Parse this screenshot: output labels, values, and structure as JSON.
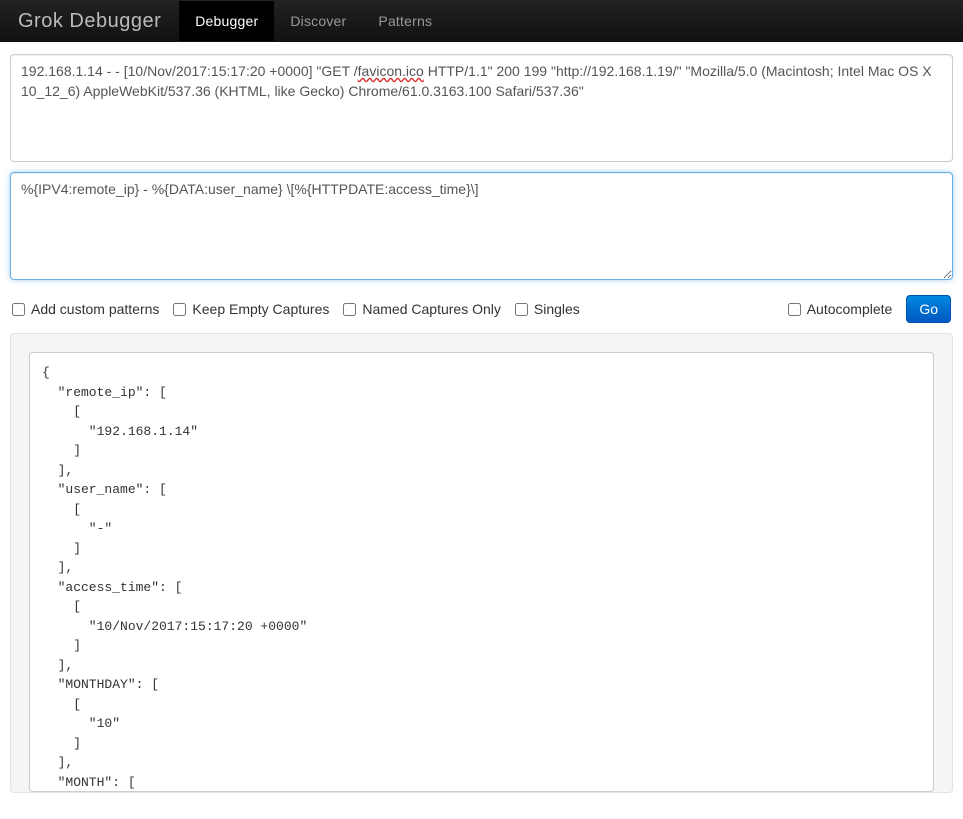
{
  "nav": {
    "brand": "Grok Debugger",
    "items": [
      {
        "label": "Debugger",
        "active": true
      },
      {
        "label": "Discover",
        "active": false
      },
      {
        "label": "Patterns",
        "active": false
      }
    ]
  },
  "inputs": {
    "log_prefix": "192.168.1.14 - - [10/Nov/2017:15:17:20 +0000] \"GET /",
    "log_misspell": "favicon.ico",
    "log_suffix": " HTTP/1.1\" 200 199 \"http://192.168.1.19/\" \"Mozilla/5.0 (Macintosh; Intel Mac OS X 10_12_6) AppleWebKit/537.36 (KHTML, like Gecko) Chrome/61.0.3163.100 Safari/537.36\"",
    "pattern_value": "%{IPV4:remote_ip} - %{DATA:user_name} \\[%{HTTPDATE:access_time}\\]"
  },
  "options": {
    "add_custom_patterns": "Add custom patterns",
    "keep_empty_captures": "Keep Empty Captures",
    "named_captures_only": "Named Captures Only",
    "singles": "Singles",
    "autocomplete": "Autocomplete",
    "go": "Go"
  },
  "output": {
    "text": "{\n  \"remote_ip\": [\n    [\n      \"192.168.1.14\"\n    ]\n  ],\n  \"user_name\": [\n    [\n      \"-\"\n    ]\n  ],\n  \"access_time\": [\n    [\n      \"10/Nov/2017:15:17:20 +0000\"\n    ]\n  ],\n  \"MONTHDAY\": [\n    [\n      \"10\"\n    ]\n  ],\n  \"MONTH\": ["
  }
}
